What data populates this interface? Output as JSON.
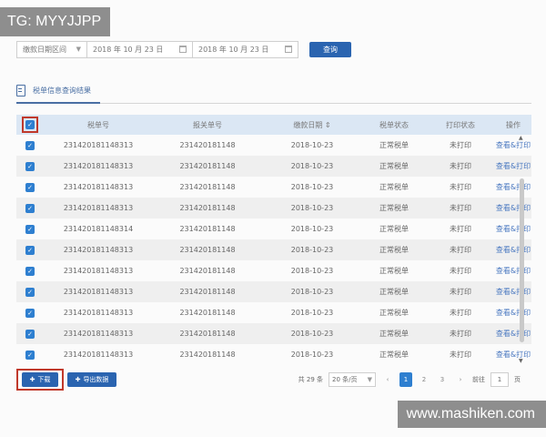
{
  "watermarks": {
    "top_left": "TG: MYYJJPP",
    "bottom_right": "www.mashiken.com"
  },
  "filters": {
    "date_type": "缴款日期区间",
    "start_date": "2018 年 10 月 23 日",
    "end_date": "2018 年 10 月 23 日",
    "query_label": "查询"
  },
  "section": {
    "title": "税单信息查询结果"
  },
  "table": {
    "columns": [
      "税单号",
      "报关单号",
      "缴款日期",
      "税单状态",
      "打印状态",
      "操作"
    ],
    "rows": [
      {
        "checked": true,
        "tax_no": "231420181148313",
        "customs_no": "231420181148",
        "date": "2018-10-23",
        "status": "正常税单",
        "print": "未打印",
        "op": "查看&打印"
      },
      {
        "checked": true,
        "tax_no": "231420181148313",
        "customs_no": "231420181148",
        "date": "2018-10-23",
        "status": "正常税单",
        "print": "未打印",
        "op": "查看&打印"
      },
      {
        "checked": true,
        "tax_no": "231420181148313",
        "customs_no": "231420181148",
        "date": "2018-10-23",
        "status": "正常税单",
        "print": "未打印",
        "op": "查看&打印"
      },
      {
        "checked": true,
        "tax_no": "231420181148313",
        "customs_no": "231420181148",
        "date": "2018-10-23",
        "status": "正常税单",
        "print": "未打印",
        "op": "查看&打印"
      },
      {
        "checked": true,
        "tax_no": "231420181148314",
        "customs_no": "231420181148",
        "date": "2018-10-23",
        "status": "正常税单",
        "print": "未打印",
        "op": "查看&打印"
      },
      {
        "checked": true,
        "tax_no": "231420181148313",
        "customs_no": "231420181148",
        "date": "2018-10-23",
        "status": "正常税单",
        "print": "未打印",
        "op": "查看&打印"
      },
      {
        "checked": true,
        "tax_no": "231420181148313",
        "customs_no": "231420181148",
        "date": "2018-10-23",
        "status": "正常税单",
        "print": "未打印",
        "op": "查看&打印"
      },
      {
        "checked": true,
        "tax_no": "231420181148313",
        "customs_no": "231420181148",
        "date": "2018-10-23",
        "status": "正常税单",
        "print": "未打印",
        "op": "查看&打印"
      },
      {
        "checked": true,
        "tax_no": "231420181148313",
        "customs_no": "231420181148",
        "date": "2018-10-23",
        "status": "正常税单",
        "print": "未打印",
        "op": "查看&打印"
      },
      {
        "checked": true,
        "tax_no": "231420181148313",
        "customs_no": "231420181148",
        "date": "2018-10-23",
        "status": "正常税单",
        "print": "未打印",
        "op": "查看&打印"
      },
      {
        "checked": true,
        "tax_no": "231420181148313",
        "customs_no": "231420181148",
        "date": "2018-10-23",
        "status": "正常税单",
        "print": "未打印",
        "op": "查看&打印"
      }
    ]
  },
  "footer": {
    "download_label": "下载",
    "export_label": "导出数据",
    "total": "共 29 条",
    "page_size": "20 条/页",
    "pages": [
      "1",
      "2",
      "3"
    ],
    "current_page": "1",
    "goto_label": "前往",
    "goto_value": "1",
    "page_unit": "页"
  },
  "colors": {
    "primary": "#2a64b0",
    "checkbox": "#2e7fd0",
    "highlight_frame": "#c0392b",
    "header_bg": "#dbe7f4"
  }
}
